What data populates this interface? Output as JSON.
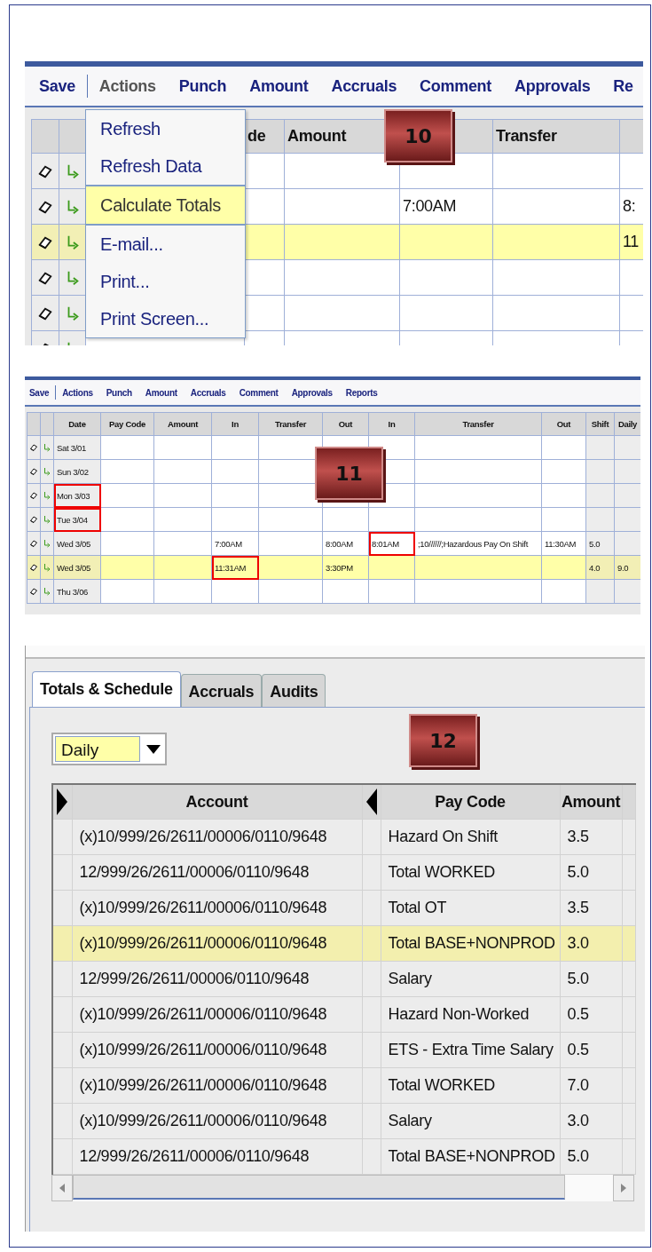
{
  "timecard_detail": {
    "menu_bar": [
      {
        "label": "Save",
        "open": false
      },
      {
        "label": "Actions",
        "open": true
      },
      {
        "label": "Punch",
        "open": false
      },
      {
        "label": "Amount",
        "open": false
      },
      {
        "label": "Accruals",
        "open": false
      },
      {
        "label": "Comment",
        "open": false
      },
      {
        "label": "Approvals",
        "open": false
      },
      {
        "label": "Re",
        "open": false
      }
    ],
    "actions_menu": {
      "groups": [
        {
          "items": [
            {
              "label": "Refresh",
              "selected": false
            },
            {
              "label": "Refresh Data",
              "selected": false
            }
          ]
        },
        {
          "items": [
            {
              "label": "Calculate Totals",
              "selected": true
            }
          ]
        },
        {
          "items": [
            {
              "label": "E-mail...",
              "selected": false
            },
            {
              "label": "Print...",
              "selected": false
            },
            {
              "label": "Print Screen...",
              "selected": false
            }
          ]
        }
      ]
    },
    "columns": [
      {},
      {
        "label": "de"
      },
      {
        "label": "Amount"
      },
      {},
      {
        "label": "Transfer"
      },
      {}
    ],
    "rows": [
      {
        "selected": false,
        "cells": [
          {},
          {},
          {},
          {},
          {},
          {}
        ]
      },
      {
        "selected": false,
        "cells": [
          {},
          {},
          {},
          {
            "text": "7:00AM"
          },
          {},
          {
            "text": "8:"
          }
        ]
      },
      {
        "selected": true,
        "cells": [
          {},
          {},
          {},
          {},
          {},
          {
            "text": "11"
          }
        ]
      },
      {
        "selected": false,
        "cells": [
          {},
          {},
          {},
          {},
          {},
          {}
        ]
      },
      {
        "selected": false,
        "cells": [
          {},
          {},
          {},
          {},
          {},
          {}
        ]
      },
      {
        "selected": false,
        "cells": [
          {},
          {},
          {},
          {},
          {},
          {}
        ]
      }
    ],
    "badge": "10"
  },
  "timecard": {
    "menu_bar": [
      {
        "label": "Save",
        "open": false
      },
      {
        "label": "Actions",
        "open": false
      },
      {
        "label": "Punch",
        "open": false
      },
      {
        "label": "Amount",
        "open": false
      },
      {
        "label": "Accruals",
        "open": false
      },
      {
        "label": "Comment",
        "open": false
      },
      {
        "label": "Approvals",
        "open": false
      },
      {
        "label": "Reports",
        "open": false
      }
    ],
    "columns": [
      {
        "label": "Date",
        "shaded": true
      },
      {
        "label": "Pay Code",
        "shaded": false
      },
      {
        "label": "Amount",
        "shaded": false
      },
      {
        "label": "In",
        "shaded": false
      },
      {
        "label": "Transfer",
        "shaded": false
      },
      {
        "label": "Out",
        "shaded": false
      },
      {
        "label": "In",
        "shaded": false
      },
      {
        "label": "Transfer",
        "shaded": false
      },
      {
        "label": "Out",
        "shaded": false
      },
      {
        "label": "Shift",
        "shaded": true
      },
      {
        "label": "Daily",
        "shaded": true
      }
    ],
    "rows": [
      {
        "selected": false,
        "cells": [
          {
            "text": "Sat 3/01",
            "flagged": false
          },
          {
            "flagged": false
          },
          {
            "flagged": false
          },
          {
            "flagged": false
          },
          {
            "flagged": false
          },
          {
            "flagged": false
          },
          {
            "flagged": false
          },
          {
            "flagged": false
          },
          {
            "flagged": false
          },
          {
            "flagged": false
          },
          {
            "flagged": false
          }
        ]
      },
      {
        "selected": false,
        "cells": [
          {
            "text": "Sun 3/02",
            "flagged": false
          },
          {
            "flagged": false
          },
          {
            "flagged": false
          },
          {
            "flagged": false
          },
          {
            "flagged": false
          },
          {},
          {
            "flagged": false
          },
          {
            "flagged": false
          },
          {
            "flagged": false
          },
          {
            "flagged": false
          },
          {
            "flagged": false
          }
        ]
      },
      {
        "selected": false,
        "cells": [
          {
            "text": "Mon 3/03",
            "flagged": true
          },
          {
            "flagged": false
          },
          {
            "flagged": false
          },
          {
            "flagged": false
          },
          {
            "flagged": false
          },
          {
            "flagged": false
          },
          {
            "flagged": false
          },
          {
            "flagged": false
          },
          {
            "flagged": false
          },
          {
            "flagged": false
          },
          {
            "flagged": false
          }
        ]
      },
      {
        "selected": false,
        "cells": [
          {
            "text": "Tue 3/04",
            "flagged": true
          },
          {
            "flagged": false
          },
          {
            "flagged": false
          },
          {
            "flagged": false
          },
          {
            "flagged": false
          },
          {
            "flagged": false
          },
          {
            "flagged": false
          },
          {
            "flagged": false
          },
          {
            "flagged": false
          },
          {
            "flagged": false
          },
          {
            "flagged": false
          }
        ]
      },
      {
        "selected": false,
        "cells": [
          {
            "text": "Wed 3/05",
            "flagged": false
          },
          {
            "flagged": false
          },
          {
            "flagged": false
          },
          {
            "text": "7:00AM",
            "flagged": false
          },
          {
            "flagged": false
          },
          {
            "text": "8:00AM",
            "flagged": false
          },
          {
            "text": "8:01AM",
            "flagged": true
          },
          {
            "text": ";10//////;Hazardous Pay On Shift",
            "flagged": false
          },
          {
            "text": "11:30AM",
            "flagged": false
          },
          {
            "text": "5.0",
            "flagged": false
          },
          {
            "flagged": false
          }
        ]
      },
      {
        "selected": true,
        "cells": [
          {
            "text": "Wed 3/05",
            "flagged": false
          },
          {
            "flagged": false
          },
          {
            "flagged": false
          },
          {
            "text": "11:31AM",
            "flagged": true
          },
          {
            "flagged": false
          },
          {
            "text": "3:30PM",
            "flagged": false
          },
          {
            "flagged": false
          },
          {
            "flagged": false
          },
          {
            "flagged": false
          },
          {
            "text": "4.0",
            "flagged": false
          },
          {
            "text": "9.0",
            "flagged": false
          }
        ]
      },
      {
        "selected": false,
        "cells": [
          {
            "text": "Thu 3/06",
            "flagged": false
          },
          {
            "flagged": false
          },
          {
            "flagged": false
          },
          {
            "flagged": false
          },
          {
            "flagged": false
          },
          {
            "flagged": false
          },
          {
            "flagged": false
          },
          {
            "flagged": false
          },
          {
            "flagged": false
          },
          {
            "flagged": false
          },
          {
            "flagged": false
          }
        ]
      }
    ],
    "badge": "11"
  },
  "totals": {
    "tabs": [
      {
        "label": "Totals & Schedule",
        "selected": true
      },
      {
        "label": "Accruals",
        "selected": false
      },
      {
        "label": "Audits",
        "selected": false
      }
    ],
    "period_select": {
      "value": "Daily"
    },
    "badge": "12",
    "columns": [
      {
        "label": "Account"
      },
      {
        "label": "Pay Code"
      },
      {
        "label": "Amount"
      },
      {}
    ],
    "rows": [
      {
        "selected": false,
        "cells": [
          "(x)10/999/26/2611/00006/0110/9648",
          "Hazard On Shift",
          "3.5"
        ]
      },
      {
        "selected": false,
        "cells": [
          "12/999/26/2611/00006/0110/9648",
          "Total WORKED",
          "5.0"
        ]
      },
      {
        "selected": false,
        "cells": [
          "(x)10/999/26/2611/00006/0110/9648",
          "Total OT",
          "3.5"
        ]
      },
      {
        "selected": true,
        "cells": [
          "(x)10/999/26/2611/00006/0110/9648",
          "Total BASE+NONPROD",
          "3.0"
        ]
      },
      {
        "selected": false,
        "cells": [
          "12/999/26/2611/00006/0110/9648",
          "Salary",
          "5.0"
        ]
      },
      {
        "selected": false,
        "cells": [
          "(x)10/999/26/2611/00006/0110/9648",
          "Hazard Non-Worked",
          "0.5"
        ]
      },
      {
        "selected": false,
        "cells": [
          "(x)10/999/26/2611/00006/0110/9648",
          "ETS - Extra Time Salary",
          "0.5"
        ]
      },
      {
        "selected": false,
        "cells": [
          "(x)10/999/26/2611/00006/0110/9648",
          "Total WORKED",
          "7.0"
        ]
      },
      {
        "selected": false,
        "cells": [
          "(x)10/999/26/2611/00006/0110/9648",
          "Salary",
          "3.0"
        ]
      },
      {
        "selected": false,
        "cells": [
          "12/999/26/2611/00006/0110/9648",
          "Total BASE+NONPROD",
          "5.0"
        ]
      }
    ]
  }
}
